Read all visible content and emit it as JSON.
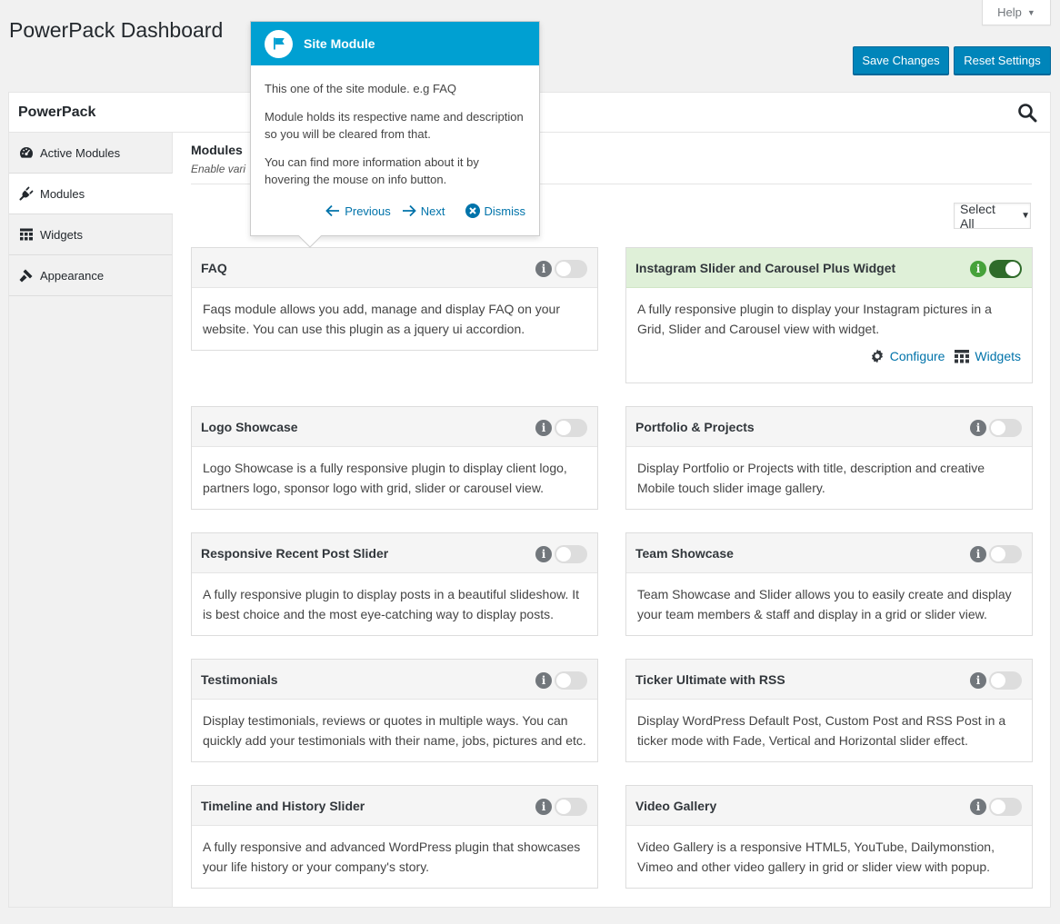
{
  "page": {
    "title": "PowerPack Dashboard"
  },
  "help": {
    "label": "Help",
    "caret": "▼"
  },
  "buttons": {
    "save": "Save Changes",
    "reset": "Reset Settings"
  },
  "panel": {
    "title": "PowerPack"
  },
  "sidebar": {
    "items": [
      {
        "label": "Active Modules",
        "icon": "dashboard-icon"
      },
      {
        "label": "Modules",
        "icon": "plug-icon"
      },
      {
        "label": "Widgets",
        "icon": "widgets-icon"
      },
      {
        "label": "Appearance",
        "icon": "brush-icon"
      }
    ]
  },
  "content": {
    "heading": "Modules",
    "subheading": "Enable vari"
  },
  "select_all": {
    "label": "Select All",
    "caret": "▼"
  },
  "modules": [
    {
      "name": "FAQ",
      "description": "Faqs module allows you add, manage and display FAQ on your website. You can use this plugin as a jquery ui accordion.",
      "enabled": false
    },
    {
      "name": "Instagram Slider and Carousel Plus Widget",
      "description": "A fully responsive plugin to display your Instagram pictures in a Grid, Slider and Carousel view with widget.",
      "enabled": true,
      "actions": {
        "configure": "Configure",
        "widgets": "Widgets"
      }
    },
    {
      "name": "Logo Showcase",
      "description": "Logo Showcase is a fully responsive plugin to display client logo, partners logo, sponsor logo with grid, slider or carousel view.",
      "enabled": false
    },
    {
      "name": "Portfolio & Projects",
      "description": "Display Portfolio or Projects with title, description and creative Mobile touch slider image gallery.",
      "enabled": false
    },
    {
      "name": "Responsive Recent Post Slider",
      "description": "A fully responsive plugin to display posts in a beautiful slideshow. It is best choice and the most eye-catching way to display posts.",
      "enabled": false
    },
    {
      "name": "Team Showcase",
      "description": "Team Showcase and Slider allows you to easily create and display your team members & staff and display in a grid or slider view.",
      "enabled": false
    },
    {
      "name": "Testimonials",
      "description": "Display testimonials, reviews or quotes in multiple ways. You can quickly add your testimonials with their name, jobs, pictures and etc.",
      "enabled": false
    },
    {
      "name": "Ticker Ultimate with RSS",
      "description": "Display WordPress Default Post, Custom Post and RSS Post in a ticker mode with Fade, Vertical and Horizontal slider effect.",
      "enabled": false
    },
    {
      "name": "Timeline and History Slider",
      "description": "A fully responsive and advanced WordPress plugin that showcases your life history or your company's story.",
      "enabled": false
    },
    {
      "name": "Video Gallery",
      "description": "Video Gallery is a responsive HTML5, YouTube, Dailymonstion, Vimeo and other video gallery in grid or slider view with popup.",
      "enabled": false
    }
  ],
  "info_glyph": "i",
  "tour": {
    "title": "Site Module",
    "paragraphs": [
      "This one of the site module. e.g FAQ",
      "Module holds its respective name and description so you will be cleared from that.",
      "You can find more information about it by hovering the mouse on info button."
    ],
    "previous": "Previous",
    "next": "Next",
    "dismiss": "Dismiss"
  },
  "colors": {
    "primary": "#0085ba",
    "tour_header": "#00a0d2",
    "enabled_bg": "#dff0d8",
    "enabled_toggle": "#2f6b2a",
    "link": "#0073aa"
  }
}
